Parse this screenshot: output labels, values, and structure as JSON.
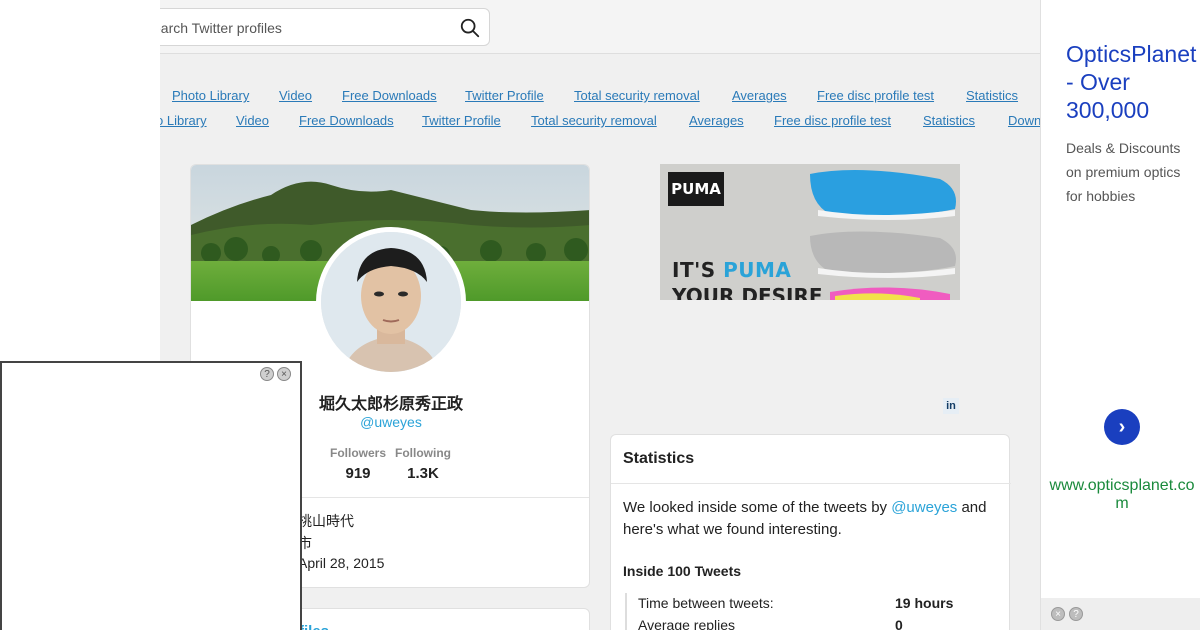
{
  "search": {
    "placeholder": "earch Twitter profiles"
  },
  "nav": {
    "row1": [
      "Photo Library",
      "Video",
      "Free Downloads",
      "Twitter Profile",
      "Total security removal",
      "Averages",
      "Free disc profile test",
      "Statistics"
    ],
    "row2": [
      "o Library",
      "Video",
      "Free Downloads",
      "Twitter Profile",
      "Total security removal",
      "Averages",
      "Free disc profile test",
      "Statistics",
      "Down"
    ]
  },
  "profile": {
    "name": "堀久太郎杉原秀正政",
    "handle": "@uweyes",
    "followers_label": "Followers",
    "followers_value": "919",
    "following_label": "Following",
    "following_value": "1.3K",
    "info": [
      "桃山時代",
      "市",
      "April 28, 2015"
    ]
  },
  "card2": {
    "title": "files"
  },
  "puma_ad": {
    "logo": "PUMA",
    "tagline_prefix": "IT'S ",
    "tagline_brand": "PUMA",
    "tagline2": "YOUR DESIRE"
  },
  "linkedin_icon": "in",
  "statistics": {
    "title": "Statistics",
    "intro_before": "We looked inside some of the tweets by ",
    "intro_handle": "@uweyes",
    "intro_after": " and here's what we found interesting.",
    "subtitle": "Inside 100 Tweets",
    "rows": [
      {
        "label": "Time between tweets:",
        "value": "19 hours"
      },
      {
        "label": "Average replies",
        "value": "0"
      }
    ]
  },
  "right_ad": {
    "headline": "OpticsPlanet - Over 300,000",
    "description": "Deals & Discounts on premium optics for hobbies",
    "arrow": "›",
    "url": "www.opticsplanet.com"
  },
  "colors": {
    "link": "#2a7ab8",
    "handle": "#2aa3d8",
    "ad_blue": "#1a3fbf",
    "ad_green": "#1a8a3c"
  }
}
